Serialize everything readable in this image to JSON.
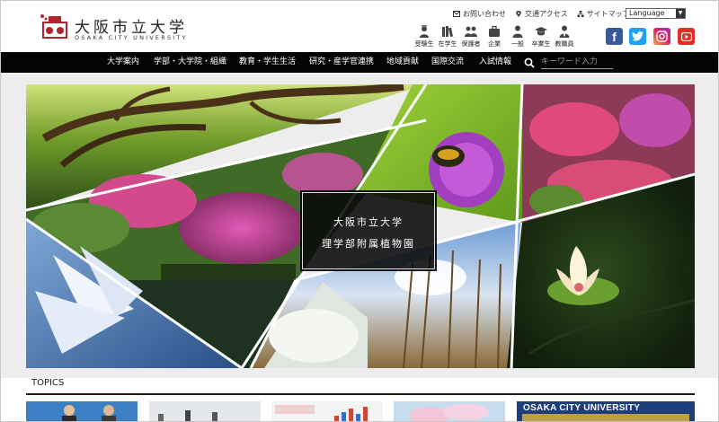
{
  "header": {
    "logo_jp": "大阪市立大学",
    "logo_en": "OSAKA CITY UNIVERSITY",
    "util_links": [
      {
        "label": "お問い合わせ",
        "icon": "mail-icon"
      },
      {
        "label": "交通アクセス",
        "icon": "map-pin-icon"
      },
      {
        "label": "サイトマップ",
        "icon": "sitemap-icon"
      }
    ],
    "language_label": "Language",
    "audience": [
      {
        "label": "受験生",
        "icon": "examinee-icon"
      },
      {
        "label": "在学生",
        "icon": "books-icon"
      },
      {
        "label": "保護者",
        "icon": "parents-icon"
      },
      {
        "label": "企業",
        "icon": "briefcase-icon"
      },
      {
        "label": "一般",
        "icon": "person-icon"
      },
      {
        "label": "卒業生",
        "icon": "graduation-cap-icon"
      },
      {
        "label": "教職員",
        "icon": "staff-icon"
      }
    ],
    "social": [
      "facebook-icon",
      "twitter-icon",
      "instagram-icon",
      "youtube-icon"
    ]
  },
  "nav": {
    "items": [
      "大学案内",
      "学部・大学院・組織",
      "教育・学生生活",
      "研究・産学官連携",
      "地域貢献",
      "国際交流",
      "入試情報"
    ],
    "search_placeholder": "キーワード入力"
  },
  "hero": {
    "caption_line1": "大阪市立大学",
    "caption_line2": "理学部附属植物園"
  },
  "topics": {
    "title": "TOPICS",
    "banner_text": "OSAKA CITY UNIVERSITY"
  },
  "colors": {
    "nav_bg": "#050505",
    "banner_blue": "#1e3d7b",
    "facebook": "#3b5998",
    "twitter": "#1da1f2",
    "youtube": "#e52d27",
    "logo_red": "#b0262c"
  }
}
